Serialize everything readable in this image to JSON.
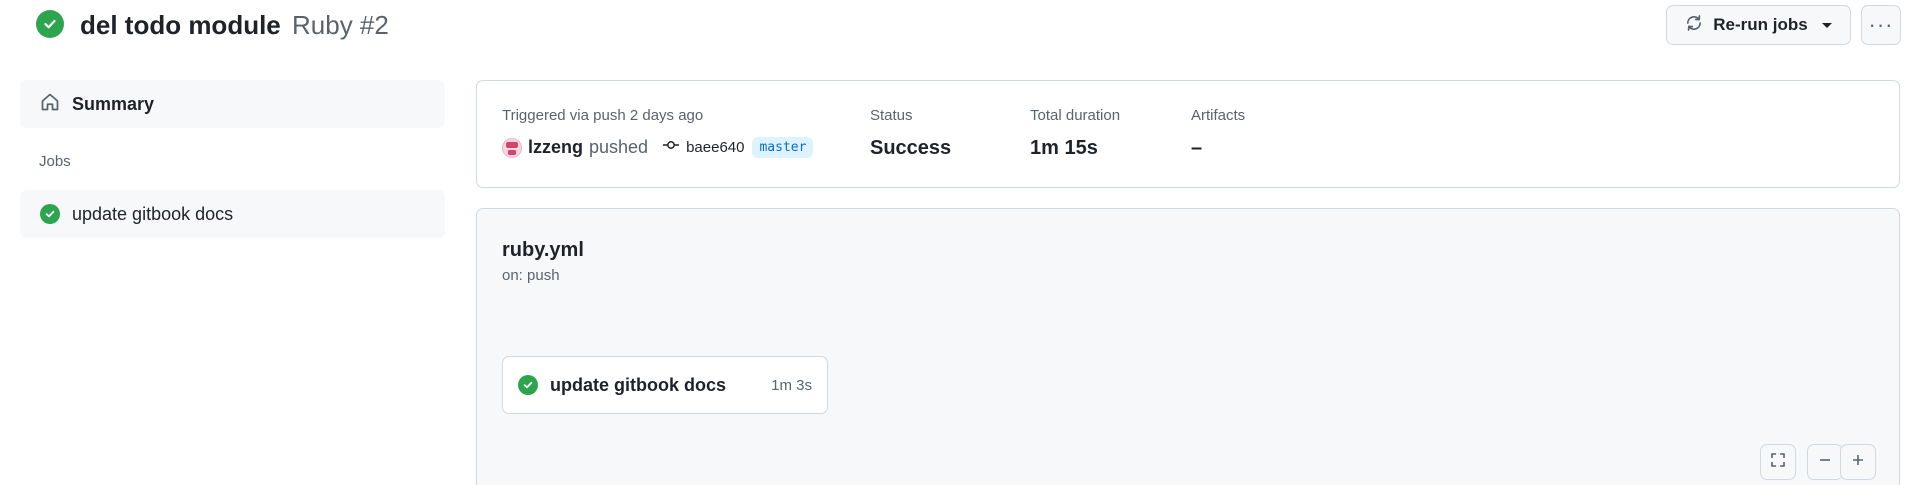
{
  "header": {
    "title": "del todo module",
    "run_label": "Ruby #2",
    "rerun_label": "Re-run jobs",
    "more_label": "···"
  },
  "sidebar": {
    "summary_label": "Summary",
    "jobs_heading": "Jobs",
    "jobs": [
      {
        "label": "update gitbook docs",
        "status": "success"
      }
    ]
  },
  "run_info": {
    "trigger_label": "Triggered via push 2 days ago",
    "actor": "lzzeng",
    "action": "pushed",
    "commit_sha": "baee640",
    "branch": "master",
    "status_label": "Status",
    "status_value": "Success",
    "duration_label": "Total duration",
    "duration_value": "1m 15s",
    "artifacts_label": "Artifacts",
    "artifacts_value": "–"
  },
  "workflow": {
    "file": "ruby.yml",
    "trigger": "on: push",
    "jobs": [
      {
        "name": "update gitbook docs",
        "duration": "1m 3s",
        "status": "success"
      }
    ]
  },
  "colors": {
    "success": "#2da44e",
    "border": "#d1d9e0",
    "muted_text": "#59636e",
    "branch_text": "#0969da",
    "branch_bg": "#ddf4ff"
  },
  "icons": {
    "title_status": "check-circle-icon",
    "rerun": "sync-icon",
    "summary": "home-icon",
    "commit": "git-commit-icon",
    "fullscreen": "screen-full-icon",
    "zoom_out": "minus-icon",
    "zoom_in": "plus-icon"
  }
}
